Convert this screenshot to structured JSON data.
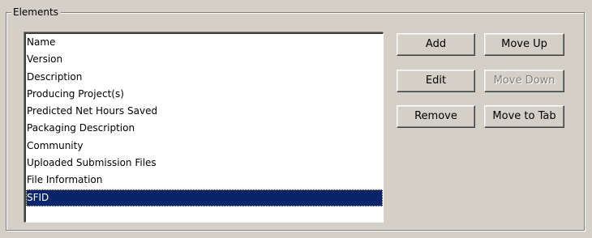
{
  "group": {
    "title": "Elements"
  },
  "list": {
    "items": [
      "Name",
      "Version",
      "Description",
      "Producing Project(s)",
      "Predicted Net Hours Saved",
      "Packaging Description",
      "Community",
      "Uploaded Submission Files",
      "File Information",
      "SFID"
    ],
    "selected_index": 9
  },
  "buttons": {
    "add": "Add",
    "edit": "Edit",
    "remove": "Remove",
    "move_up": "Move Up",
    "move_down": "Move Down",
    "move_to_tab": "Move to Tab"
  },
  "colors": {
    "face": "#d4d0c8",
    "selection": "#0a246a",
    "disabled_text": "#808080"
  }
}
